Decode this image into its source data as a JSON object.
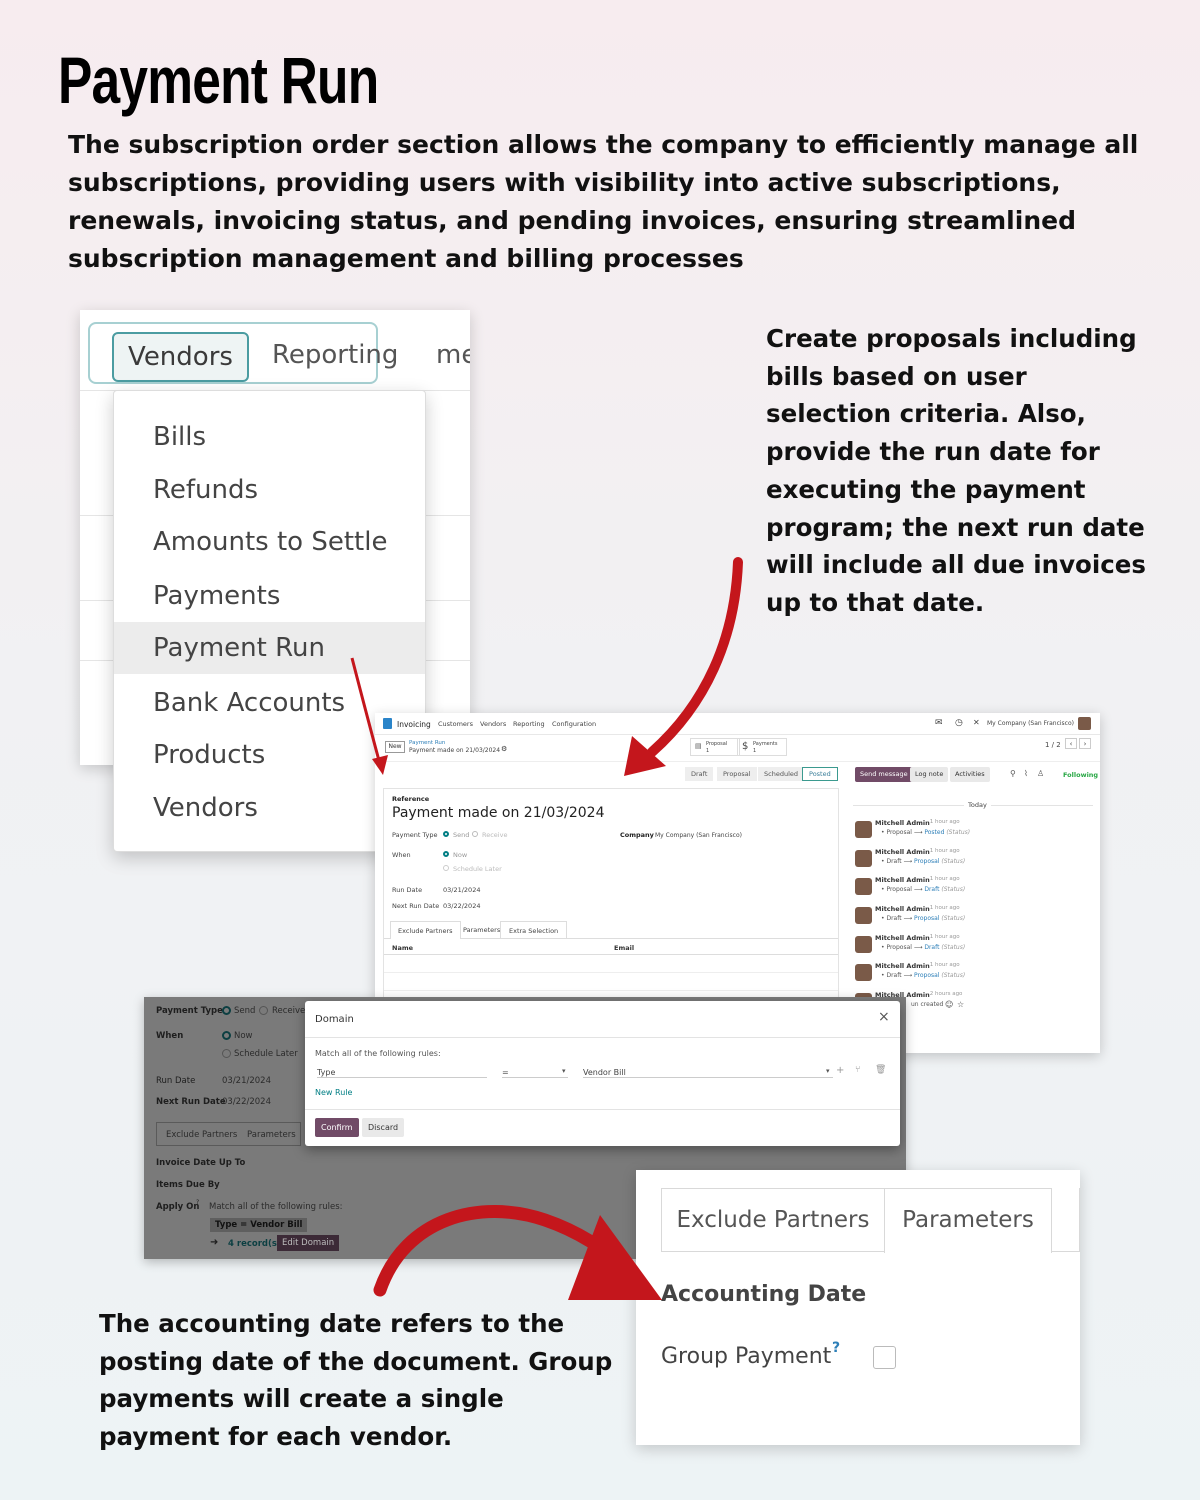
{
  "heading": "Payment Run",
  "intro": "The subscription order section allows the company to efficiently manage all subscriptions, providing users with visibility into active subscriptions, renewals, invoicing status, and pending invoices, ensuring streamlined subscription management and billing processes",
  "side_note": "Create proposals including bills based on user selection criteria. Also, provide the run date for executing the payment program; the next run date will include all due invoices up to that date.",
  "bottom_note": "The accounting date refers to the posting date of the document. Group payments will create a single payment for each vendor.",
  "colors": {
    "arrow": "#c4161c",
    "odoo_primary": "#714b67",
    "teal": "#017e84"
  },
  "menu": {
    "tabs": {
      "vendors": "Vendors",
      "reporting": "Reporting",
      "cut": "me"
    },
    "items": [
      "Bills",
      "Refunds",
      "Amounts to Settle",
      "Payments",
      "Payment Run",
      "Bank Accounts",
      "Products",
      "Vendors"
    ],
    "active": "Payment Run"
  },
  "form": {
    "nav": {
      "app": "Invoicing",
      "menus": [
        "Customers",
        "Vendors",
        "Reporting",
        "Configuration"
      ],
      "company": "My Company (San Francisco)"
    },
    "new_btn": "New",
    "breadcrumb": "Payment Run",
    "record": "Payment made on 21/03/2024",
    "smart": {
      "proposal_label": "Proposal",
      "proposal_count": "1",
      "payments_label": "Payments",
      "payments_count": "1"
    },
    "pager": "1 / 2",
    "stages": [
      "Draft",
      "Proposal",
      "Scheduled",
      "Posted"
    ],
    "chatter_btns": {
      "send": "Send message",
      "log": "Log note",
      "activities": "Activities",
      "following": "Following"
    },
    "reference_label": "Reference",
    "title": "Payment made on 21/03/2024",
    "payment_type_label": "Payment Type",
    "send": "Send",
    "receive": "Receive",
    "company_label": "Company",
    "company_value": "My Company (San Francisco)",
    "when_label": "When",
    "now": "Now",
    "schedule_later": "Schedule Later",
    "run_date_label": "Run Date",
    "run_date": "03/21/2024",
    "next_run_label": "Next Run Date",
    "next_run": "03/22/2024",
    "tabs": [
      "Exclude Partners",
      "Parameters",
      "Extra Selection"
    ],
    "cols": {
      "name": "Name",
      "email": "Email"
    },
    "today": "Today",
    "messages": [
      {
        "author": "Mitchell Admin",
        "ago": "- 1 hour ago",
        "from": "Proposal",
        "to": "Posted",
        "field": "(Status)"
      },
      {
        "author": "Mitchell Admin",
        "ago": "- 1 hour ago",
        "from": "Draft",
        "to": "Proposal",
        "field": "(Status)"
      },
      {
        "author": "Mitchell Admin",
        "ago": "- 1 hour ago",
        "from": "Proposal",
        "to": "Draft",
        "field": "(Status)"
      },
      {
        "author": "Mitchell Admin",
        "ago": "- 1 hour ago",
        "from": "Draft",
        "to": "Proposal",
        "field": "(Status)"
      },
      {
        "author": "Mitchell Admin",
        "ago": "- 1 hour ago",
        "from": "Proposal",
        "to": "Draft",
        "field": "(Status)"
      },
      {
        "author": "Mitchell Admin",
        "ago": "- 1 hour ago",
        "from": "Draft",
        "to": "Proposal",
        "field": "(Status)"
      },
      {
        "author": "Mitchell Admin",
        "ago": "- 2 hours ago",
        "created": "un created"
      }
    ]
  },
  "domain": {
    "bg": {
      "payment_type_label": "Payment Type",
      "send": "Send",
      "receive": "Receive",
      "when_label": "When",
      "now": "Now",
      "schedule_later": "Schedule Later",
      "run_date_label": "Run Date",
      "run_date": "03/21/2024",
      "next_run_label": "Next Run Date",
      "next_run": "03/22/2024",
      "tab1": "Exclude Partners",
      "tab2": "Parameters",
      "invoice_date": "Invoice Date Up To",
      "items_due": "Items Due By",
      "apply_on": "Apply On",
      "apply_sup": "?",
      "apply_rule": "Match all of the following rules:",
      "chip": "Type = Vendor Bill",
      "records": "4 record(s)",
      "edit_domain": "Edit Domain"
    },
    "dialog": {
      "title": "Domain",
      "match": "Match all of the following rules:",
      "field": "Type",
      "operator": "=",
      "value": "Vendor Bill",
      "new_rule": "New Rule",
      "confirm": "Confirm",
      "discard": "Discard"
    }
  },
  "params": {
    "tab1": "Exclude Partners",
    "tab2": "Parameters",
    "accounting_date": "Accounting Date",
    "group_payment": "Group Payment",
    "help": "?"
  }
}
